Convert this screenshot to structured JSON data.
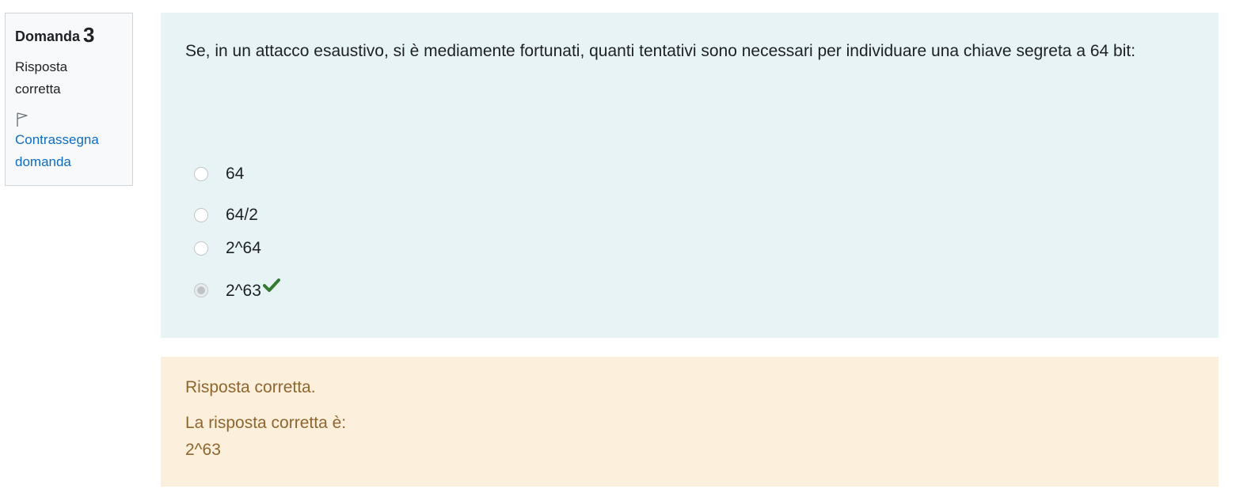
{
  "info": {
    "question_label": "Domanda",
    "question_number": "3",
    "state_line1": "Risposta",
    "state_line2": "corretta",
    "flag_icon": "flag-outline-icon",
    "flag_link_line1": "Contrassegna",
    "flag_link_line2": "domanda"
  },
  "question": {
    "text": "Se, in un attacco esaustivo, si è mediamente fortunati, quanti tentativi sono necessari per individuare una chiave segreta a 64 bit:",
    "answers": [
      {
        "label": "64",
        "selected": false
      },
      {
        "label": "64/2",
        "selected": false
      },
      {
        "label": "2^64",
        "selected": false
      },
      {
        "label": "2^63",
        "selected": true,
        "correct_mark_icon": "checkmark-icon"
      }
    ]
  },
  "outcome": {
    "feedback": "Risposta corretta.",
    "right_answer_intro": "La risposta corretta è:",
    "right_answer_value": "2^63"
  },
  "colors": {
    "formulation_bg": "#e7f3f5",
    "outcome_bg": "#fcefdc",
    "outcome_text": "#8e662e",
    "link": "#0f6cbf",
    "check": "#357a32"
  }
}
